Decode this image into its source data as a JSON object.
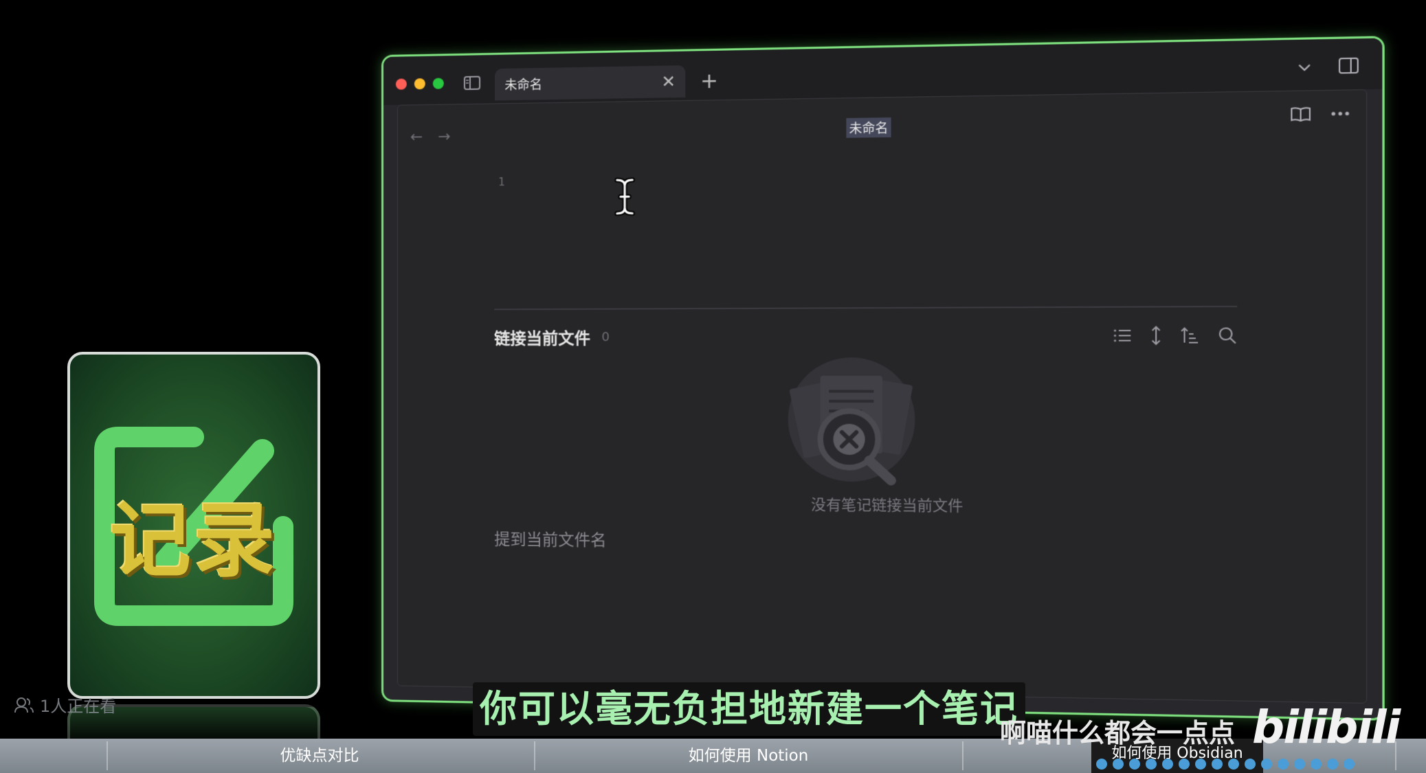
{
  "window": {
    "tab_title": "未命名",
    "tab_close": "✕",
    "new_tab": "+",
    "nav_back": "←",
    "nav_forward": "→",
    "view_title": "未命名",
    "line_number": "1"
  },
  "backlinks": {
    "title": "链接当前文件",
    "count": "0",
    "empty_text": "没有笔记链接当前文件",
    "mentions_title": "提到当前文件名"
  },
  "card": {
    "title": "记录"
  },
  "overlay": {
    "viewers": "1人正在看",
    "subtitle": "你可以毫无负担地新建一个笔记",
    "uploader": "啊喵什么都会一点点",
    "bili_logo": "bilibili"
  },
  "chapters": [
    {
      "label": "优缺点对比"
    },
    {
      "label": "如何使用 Notion"
    },
    {
      "label": "如何使用 Obsidian"
    }
  ],
  "colors": {
    "window_border": "#7ee07e",
    "subtitle": "#a8f0b0",
    "card_text": "#d9c13a",
    "progress": "#4a9dd6"
  },
  "icons": [
    "sidebar-toggle-icon",
    "close-icon",
    "plus-icon",
    "chevron-down-icon",
    "right-panel-icon",
    "arrow-left-icon",
    "arrow-right-icon",
    "book-open-icon",
    "more-icon",
    "text-cursor-icon",
    "list-icon",
    "expand-vertical-icon",
    "sort-icon",
    "search-icon",
    "no-results-icon",
    "viewers-icon"
  ]
}
